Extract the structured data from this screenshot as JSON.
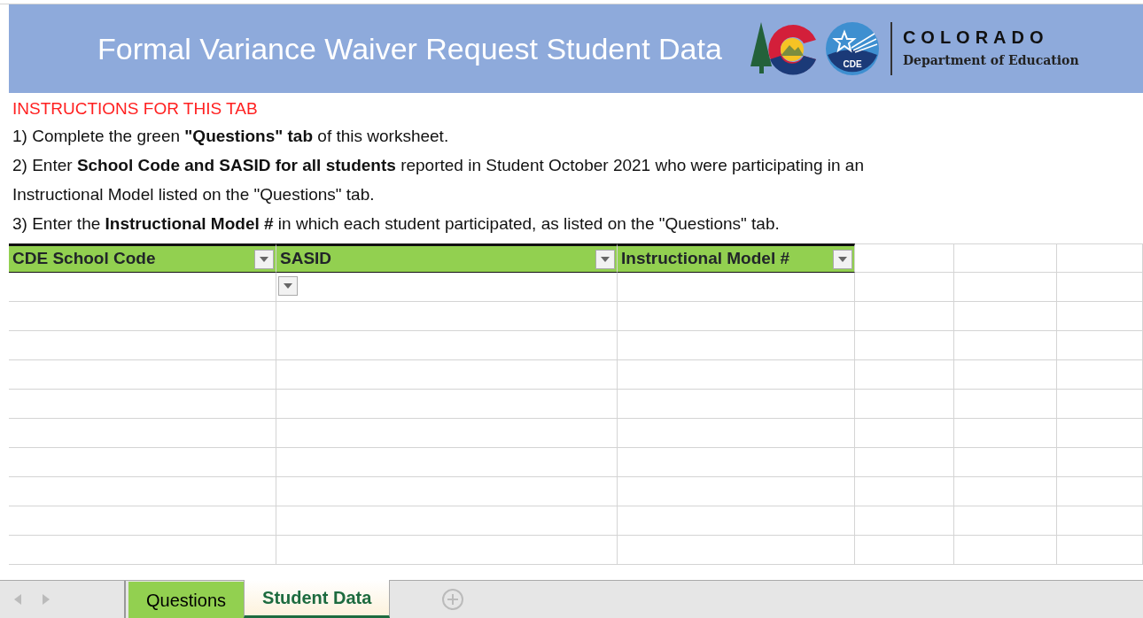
{
  "banner": {
    "title": "Formal Variance Waiver Request Student Data",
    "logo": {
      "seal_text": "CDE",
      "name": "COLORADO",
      "subtitle": "Department of Education"
    }
  },
  "instructions": {
    "heading": "INSTRUCTIONS FOR THIS TAB",
    "lines": [
      "1) Complete the green **\"Questions\" tab** of this worksheet.",
      "2) Enter **School Code and SASID for all students** reported in Student October 2021 who were participating in an",
      "Instructional Model listed on the \"Questions\" tab.",
      "3) Enter the **Instructional Model #** in which each student participated, as listed on the \"Questions\" tab."
    ]
  },
  "table": {
    "columns": [
      "CDE School Code",
      "SASID",
      "Instructional Model #"
    ]
  },
  "sheet_tabs": [
    {
      "label": "Questions",
      "selected": false,
      "color": "#92d050"
    },
    {
      "label": "Student Data",
      "selected": true,
      "color": "#fdf2dc"
    }
  ]
}
